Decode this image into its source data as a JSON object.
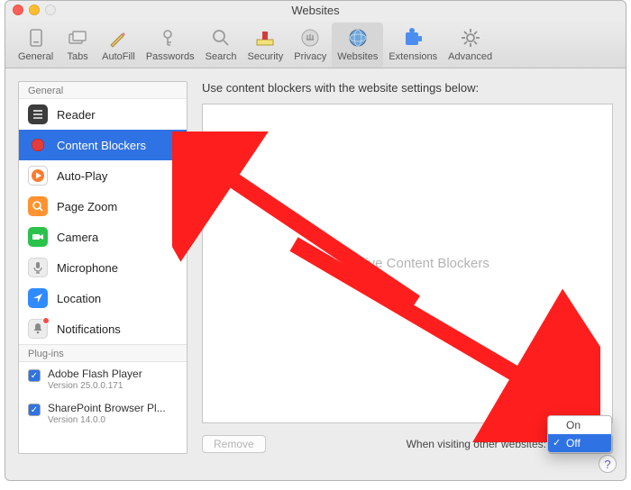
{
  "window": {
    "title": "Websites"
  },
  "toolbar": [
    {
      "id": "general",
      "label": "General"
    },
    {
      "id": "tabs",
      "label": "Tabs"
    },
    {
      "id": "autofill",
      "label": "AutoFill"
    },
    {
      "id": "passwords",
      "label": "Passwords"
    },
    {
      "id": "search",
      "label": "Search"
    },
    {
      "id": "security",
      "label": "Security"
    },
    {
      "id": "privacy",
      "label": "Privacy"
    },
    {
      "id": "websites",
      "label": "Websites",
      "selected": true
    },
    {
      "id": "extensions",
      "label": "Extensions"
    },
    {
      "id": "advanced",
      "label": "Advanced"
    }
  ],
  "sidebar": {
    "sections": [
      {
        "title": "General",
        "items": [
          {
            "id": "reader",
            "label": "Reader"
          },
          {
            "id": "content-blockers",
            "label": "Content Blockers",
            "selected": true
          },
          {
            "id": "auto-play",
            "label": "Auto-Play"
          },
          {
            "id": "page-zoom",
            "label": "Page Zoom"
          },
          {
            "id": "camera",
            "label": "Camera"
          },
          {
            "id": "microphone",
            "label": "Microphone"
          },
          {
            "id": "location",
            "label": "Location"
          },
          {
            "id": "notifications",
            "label": "Notifications",
            "badge": true
          }
        ]
      },
      {
        "title": "Plug-ins",
        "plugins": [
          {
            "label": "Adobe Flash Player",
            "version": "Version 25.0.0.171",
            "checked": true
          },
          {
            "label": "SharePoint Browser Pl...",
            "version": "Version 14.0.0",
            "checked": true
          }
        ]
      }
    ]
  },
  "main": {
    "heading": "Use content blockers with the website settings below:",
    "empty_text": "No Active Content Blockers",
    "remove_label": "Remove",
    "visiting_label": "When visiting other websites:",
    "dropdown": {
      "selected": "Off",
      "options": [
        "On",
        "Off"
      ]
    }
  },
  "colors": {
    "accent": "#2f72e4",
    "arrow": "#ff1e1e"
  }
}
